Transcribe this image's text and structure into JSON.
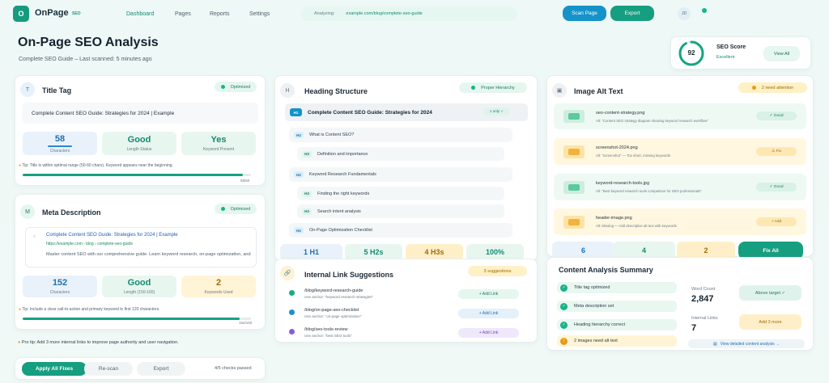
{
  "nav": {
    "logo_letter": "O",
    "app_name": "OnPage",
    "app_badge": "SEO",
    "links": [
      "Dashboard",
      "Pages",
      "Reports",
      "Settings"
    ],
    "analyzing_label": "Analyzing:",
    "analyzing_url": "example.com/blog/complete-seo-guide",
    "scan_button": "Scan Page",
    "export_button": "Export",
    "avatar_initials": "JD"
  },
  "header": {
    "title": "On-Page SEO Analysis",
    "subtitle": "Complete SEO Guide – Last scanned: 5 minutes ago"
  },
  "score": {
    "value": "92",
    "fraction": 0.92,
    "label": "SEO Score",
    "rating": "Excellent",
    "view_all": "View All"
  },
  "title_tag": {
    "icon": "T",
    "title": "Title Tag",
    "badge": "Optimized",
    "value": "Complete Content SEO Guide: Strategies for 2024 | Example",
    "stats": [
      {
        "value": "58",
        "label": "Characters"
      },
      {
        "value": "Good",
        "label": "Length Status"
      },
      {
        "value": "Yes",
        "label": "Keyword Present"
      }
    ],
    "tip": "Tip: Title is within optimal range (50-60 chars). Keyword appears near the beginning.",
    "progress_text": "58/60",
    "progress_fraction": 0.966
  },
  "meta": {
    "icon": "M",
    "title": "Meta Description",
    "badge": "Optimized",
    "serp_title": "Complete Content SEO Guide: Strategies for 2024 | Example",
    "serp_url": "https://example.com › blog › complete-seo-guide",
    "serp_desc": "Master content SEO with our comprehensive guide. Learn keyword research, on-page optimization, and",
    "stats": [
      {
        "value": "152",
        "label": "Characters"
      },
      {
        "value": "Good",
        "label": "Length (150-160)"
      },
      {
        "value": "2",
        "label": "Keywords Used"
      }
    ],
    "tip": "Tip: Include a clear call-to-action and primary keyword in first 120 characters.",
    "progress_text": "152/160",
    "progress_fraction": 0.95
  },
  "pro_tip": "Pro tip: Add 3 more internal links to improve page authority and user navigation.",
  "footer": {
    "apply": "Apply All Fixes",
    "rescan": "Re-scan",
    "export": "Export",
    "checks": "4/5 checks passed"
  },
  "headings": {
    "icon": "H",
    "title": "Heading Structure",
    "badge": "Proper Hierarchy",
    "h1": {
      "tag": "H1",
      "text": "Complete Content SEO Guide: Strategies for 2024",
      "badge": "1 only ✓"
    },
    "items": [
      {
        "tag": "H2",
        "text": "What is Content SEO?"
      },
      {
        "tag": "H3",
        "text": "Definition and importance"
      },
      {
        "tag": "H2",
        "text": "Keyword Research Fundamentals"
      },
      {
        "tag": "H3",
        "text": "Finding the right keywords"
      },
      {
        "tag": "H3",
        "text": "Search intent analysis"
      },
      {
        "tag": "H2",
        "text": "On-Page Optimization Checklist"
      }
    ],
    "stats": [
      "1 H1",
      "5 H2s",
      "4 H3s",
      "100%"
    ]
  },
  "links": {
    "title": "Internal Link Suggestions",
    "badge": "3 suggestions",
    "items": [
      {
        "path": "/blog/keyword-research-guide",
        "anchor": "Use anchor: \"keyword research strategies\"",
        "button": "+ Add Link",
        "color": "#1aa88c"
      },
      {
        "path": "/blog/on-page-seo-checklist",
        "anchor": "Use anchor: \"on-page optimization\"",
        "button": "+ Add Link",
        "color": "#1e8fd0"
      },
      {
        "path": "/blog/seo-tools-review",
        "anchor": "Use anchor: \"best SEO tools\"",
        "button": "+ Add Link",
        "color": "#8a5cd6"
      }
    ]
  },
  "images": {
    "title": "Image Alt Text",
    "badge": "2 need attention",
    "items": [
      {
        "file": "seo-content-strategy.png",
        "alt": "Alt: \"Content SEO strategy diagram showing keyword research workflow\"",
        "status": "✓ Good",
        "state": "good"
      },
      {
        "file": "screenshot-2024.png",
        "alt": "Alt: \"screenshot\" — Too short, missing keywords",
        "status": "⚠ Fix",
        "state": "warn"
      },
      {
        "file": "keyword-research-tools.jpg",
        "alt": "Alt: \"Best keyword research tools comparison for SEO professionals\"",
        "status": "✓ Good",
        "state": "good"
      },
      {
        "file": "header-image.png",
        "alt": "Alt: Missing — Add descriptive alt text with keywords",
        "status": "+ Add",
        "state": "warn"
      }
    ],
    "stats": [
      "6",
      "4",
      "2"
    ],
    "fix_all": "Fix All"
  },
  "summary": {
    "title": "Content Analysis Summary",
    "checks": [
      {
        "text": "Title tag optimized",
        "ok": true
      },
      {
        "text": "Meta description set",
        "ok": true
      },
      {
        "text": "Heading hierarchy correct",
        "ok": true
      },
      {
        "text": "2 images need alt text",
        "ok": false
      }
    ],
    "word_count_label": "Word Count",
    "word_count": "2,847",
    "word_badge": "Above target ✓",
    "internal_label": "Internal Links",
    "internal_count": "7",
    "internal_badge": "Add 3 more",
    "view_link": "View detailed content analysis →"
  }
}
